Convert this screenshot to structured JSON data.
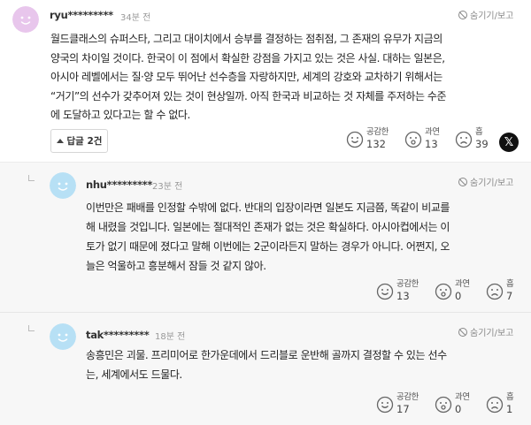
{
  "hide_label": "숨기기/보고",
  "reaction_labels": {
    "like": "공감한",
    "surprise": "과연",
    "sad": "흠"
  },
  "main_comment": {
    "username": "ryu*********",
    "time": "34분 전",
    "lines": [
      "월드클래스의 슈퍼스타, 그리고 대이치에서 승부를 결정하는 점취점, 그 존재의 유무가 지금의",
      "양국의 차이일 것이다. 한국이 이 점에서 확실한 강점을 가지고 있는 것은 사실. 대하는 일본은,",
      "아시아 레벨에서는 질·양 모두 뛰어난 선수층을 자랑하지만, 세계의 강호와 교차하기 위해서는",
      "“거기”의 선수가 갖추어져 있는 것이 현상일까. 아직 한국과 비교하는 것 자체를 주저하는 수준",
      "에 도달하고 있다고는 할 수 없다."
    ],
    "reply_button": "답글 2건",
    "counts": {
      "like": "132",
      "surprise": "13",
      "sad": "39"
    },
    "share_icon": "x-logo-icon"
  },
  "replies": [
    {
      "username": "nhu*********",
      "time": "23분 전",
      "lines": [
        "이번만은 패배를 인정할 수밖에 없다. 반대의 입장이라면 일본도 지금쯤, 똑같이 비교를",
        "해 내렸을 것입니다. 일본에는 절대적인 존재가 없는 것은 확실하다. 아시아컵에서는 이",
        "토가 없기 때문에 졌다고 말해 이번에는 2군이라든지 말하는 경우가 아니다. 어쩐지, 오",
        "늘은 억울하고 흥분해서 잠들 것 같지 않아."
      ],
      "counts": {
        "like": "13",
        "surprise": "0",
        "sad": "7"
      }
    },
    {
      "username": "tak*********",
      "time": "18분 전",
      "lines": [
        "송흥민은 괴물. 프리미어로 한가운데에서 드리블로 운반해 골까지 결정할 수 있는 선수",
        "는, 세계에서도 드물다."
      ],
      "counts": {
        "like": "17",
        "surprise": "0",
        "sad": "1"
      }
    }
  ],
  "colors": {
    "main_avatar": "#e8c6ec",
    "reply_avatar": "#b7e0f5",
    "reply_bg": "#f7f7f7"
  }
}
